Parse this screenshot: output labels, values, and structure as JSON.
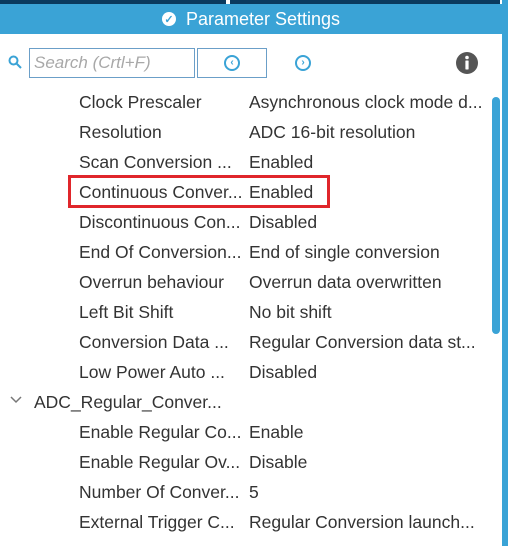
{
  "header": {
    "title": "Parameter Settings",
    "icon": "check-circle-icon",
    "accent_color": "#3aa3d6"
  },
  "toolbar": {
    "search_placeholder": "Search (Crtl+F)",
    "search_value": "",
    "prev_icon": "circle-arrow-left-icon",
    "next_icon": "circle-arrow-right-icon",
    "info_icon": "info-icon"
  },
  "parameters": [
    {
      "name": "Clock Prescaler",
      "value": "Asynchronous clock mode d..."
    },
    {
      "name": "Resolution",
      "value": "ADC 16-bit resolution"
    },
    {
      "name": "Scan Conversion ...",
      "value": "Enabled"
    },
    {
      "name": "Continuous Conver...",
      "value": "Enabled"
    },
    {
      "name": "Discontinuous Con...",
      "value": "Disabled"
    },
    {
      "name": "End Of Conversion...",
      "value": "End of single conversion"
    },
    {
      "name": "Overrun behaviour",
      "value": "Overrun data overwritten"
    },
    {
      "name": "Left Bit Shift",
      "value": "No bit shift"
    },
    {
      "name": "Conversion Data ...",
      "value": "Regular Conversion data st..."
    },
    {
      "name": "Low Power Auto ...",
      "value": "Disabled"
    }
  ],
  "group": {
    "name": "ADC_Regular_Conver...",
    "expanded": true,
    "items": [
      {
        "name": "Enable Regular Co...",
        "value": "Enable"
      },
      {
        "name": "Enable Regular Ov...",
        "value": "Disable"
      },
      {
        "name": "Number Of Conver...",
        "value": "5"
      },
      {
        "name": "External Trigger C...",
        "value": "Regular Conversion launch..."
      }
    ]
  },
  "highlight_color": "#e0262b"
}
